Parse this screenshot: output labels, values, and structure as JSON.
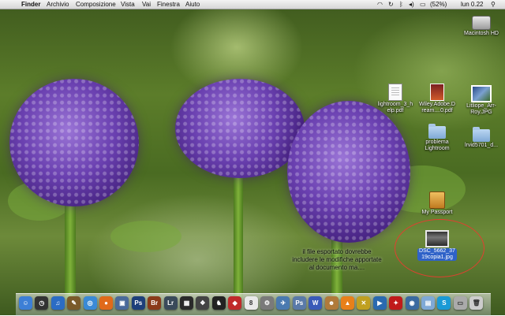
{
  "menubar": {
    "apple_glyph": "",
    "app_name": "Finder",
    "menus": [
      "Archivio",
      "Composizione",
      "Vista",
      "Vai",
      "Finestra",
      "Aiuto"
    ],
    "battery": "(52%)",
    "clock": "lun 0.22"
  },
  "desktop_icons": {
    "macintosh_hd": "Macintosh HD",
    "lightroom_pdf": "lightroom_3_h\nelp.pdf",
    "wiley_pdf": "Wiley.Adobe.D\nream....0.pdf",
    "litliope_jpg": "Litliope_Arr-\nRoy.JPG",
    "problema_lightroom": "problema\nLightroom",
    "ervid_folder": "lrvid5701_d...",
    "my_passport": "My Passport",
    "dsc_jpg": "DSC_5662_37\n19copia1.jpg"
  },
  "annotation": {
    "text": "il file esportato dovrebbe\nincludere le modifiche apportate\nal documento ma...."
  },
  "dock_items": [
    {
      "icon": "finder-icon",
      "color": "#3d7fd6",
      "glyph": "☺"
    },
    {
      "icon": "dashboard-icon",
      "color": "#333333",
      "glyph": "◷"
    },
    {
      "icon": "itunes-icon",
      "color": "#2b6cc4",
      "glyph": "♫"
    },
    {
      "icon": "preview-icon",
      "color": "#7a5a2a",
      "glyph": "✎"
    },
    {
      "icon": "safari-icon",
      "color": "#3a8ad6",
      "glyph": "◎"
    },
    {
      "icon": "firefox-icon",
      "color": "#e06a1a",
      "glyph": "●"
    },
    {
      "icon": "iphoto-icon",
      "color": "#4a6a9a",
      "glyph": "▣"
    },
    {
      "icon": "photoshop-icon",
      "color": "#1d3f7a",
      "glyph": "Ps"
    },
    {
      "icon": "bridge-icon",
      "color": "#8a3a1a",
      "glyph": "Br"
    },
    {
      "icon": "lightroom-icon",
      "color": "#3a4a5a",
      "glyph": "Lr"
    },
    {
      "icon": "photo-app-icon",
      "color": "#2a2a2a",
      "glyph": "▦"
    },
    {
      "icon": "film-icon",
      "color": "#444444",
      "glyph": "❖"
    },
    {
      "icon": "chess-icon",
      "color": "#222222",
      "glyph": "♞"
    },
    {
      "icon": "red-app-icon",
      "color": "#c02a2a",
      "glyph": "◆"
    },
    {
      "icon": "ical-icon",
      "color": "#e9e9e9",
      "glyph": "8"
    },
    {
      "icon": "preferences-icon",
      "color": "#7a7a7a",
      "glyph": "⚙"
    },
    {
      "icon": "safari-alt-icon",
      "color": "#4a7ab0",
      "glyph": "✈"
    },
    {
      "icon": "ps-icon",
      "color": "#5a7aa8",
      "glyph": "Ps"
    },
    {
      "icon": "w-icon",
      "color": "#3a5ab8",
      "glyph": "W"
    },
    {
      "icon": "face-icon",
      "color": "#b07a3a",
      "glyph": "☻"
    },
    {
      "icon": "vlc-icon",
      "color": "#e8801a",
      "glyph": "▲"
    },
    {
      "icon": "x-icon",
      "color": "#c0a020",
      "glyph": "✕"
    },
    {
      "icon": "quicktime-icon",
      "color": "#2a6ab0",
      "glyph": "▶"
    },
    {
      "icon": "acrobat-icon",
      "color": "#c01a1a",
      "glyph": "✦"
    },
    {
      "icon": "network-icon",
      "color": "#3a6aa0",
      "glyph": "◉"
    },
    {
      "icon": "folder-icon",
      "color": "#7fa9d6",
      "glyph": "▤"
    },
    {
      "icon": "skype-icon",
      "color": "#1a9ad6",
      "glyph": "S"
    },
    {
      "icon": "disk-icon",
      "color": "#aaaaaa",
      "glyph": "▭"
    },
    {
      "icon": "trash-icon",
      "color": "#cccccc",
      "glyph": "🗑"
    }
  ],
  "colors": {
    "annotation_circle": "#e04030",
    "selection_label": "#2f62c8"
  }
}
